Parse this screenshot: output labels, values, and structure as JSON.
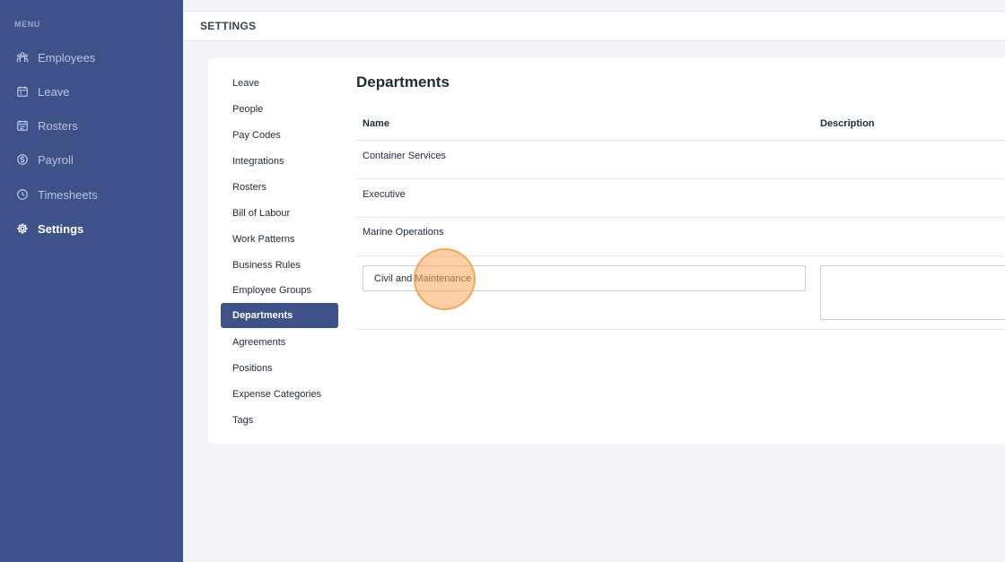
{
  "sidebar": {
    "menu_label": "MENU",
    "items": [
      {
        "label": "Employees",
        "icon": "people-icon"
      },
      {
        "label": "Leave",
        "icon": "calendar-icon"
      },
      {
        "label": "Rosters",
        "icon": "roster-icon"
      },
      {
        "label": "Payroll",
        "icon": "dollar-icon"
      },
      {
        "label": "Timesheets",
        "icon": "clock-icon"
      },
      {
        "label": "Settings",
        "icon": "gear-icon",
        "active": true
      }
    ]
  },
  "header": {
    "title": "SETTINGS"
  },
  "settings_nav": {
    "items": [
      {
        "label": "Leave"
      },
      {
        "label": "People"
      },
      {
        "label": "Pay Codes"
      },
      {
        "label": "Integrations"
      },
      {
        "label": "Rosters"
      },
      {
        "label": "Bill of Labour"
      },
      {
        "label": "Work Patterns"
      },
      {
        "label": "Business Rules"
      },
      {
        "label": "Employee Groups"
      },
      {
        "label": "Departments",
        "active": true
      },
      {
        "label": "Agreements"
      },
      {
        "label": "Positions"
      },
      {
        "label": "Expense Categories"
      },
      {
        "label": "Tags"
      }
    ]
  },
  "departments": {
    "title": "Departments",
    "columns": [
      "Name",
      "Description"
    ],
    "rows": [
      {
        "name": "Container Services",
        "description": ""
      },
      {
        "name": "Executive",
        "description": ""
      },
      {
        "name": "Marine Operations",
        "description": ""
      }
    ],
    "new_row": {
      "name_value": "Civil and Maintenance",
      "description_value": ""
    }
  },
  "colors": {
    "sidebar_bg": "#3f5189",
    "accent": "#3f5189",
    "page_bg": "#f3f3f8",
    "click_marker": "#f6a24c"
  }
}
